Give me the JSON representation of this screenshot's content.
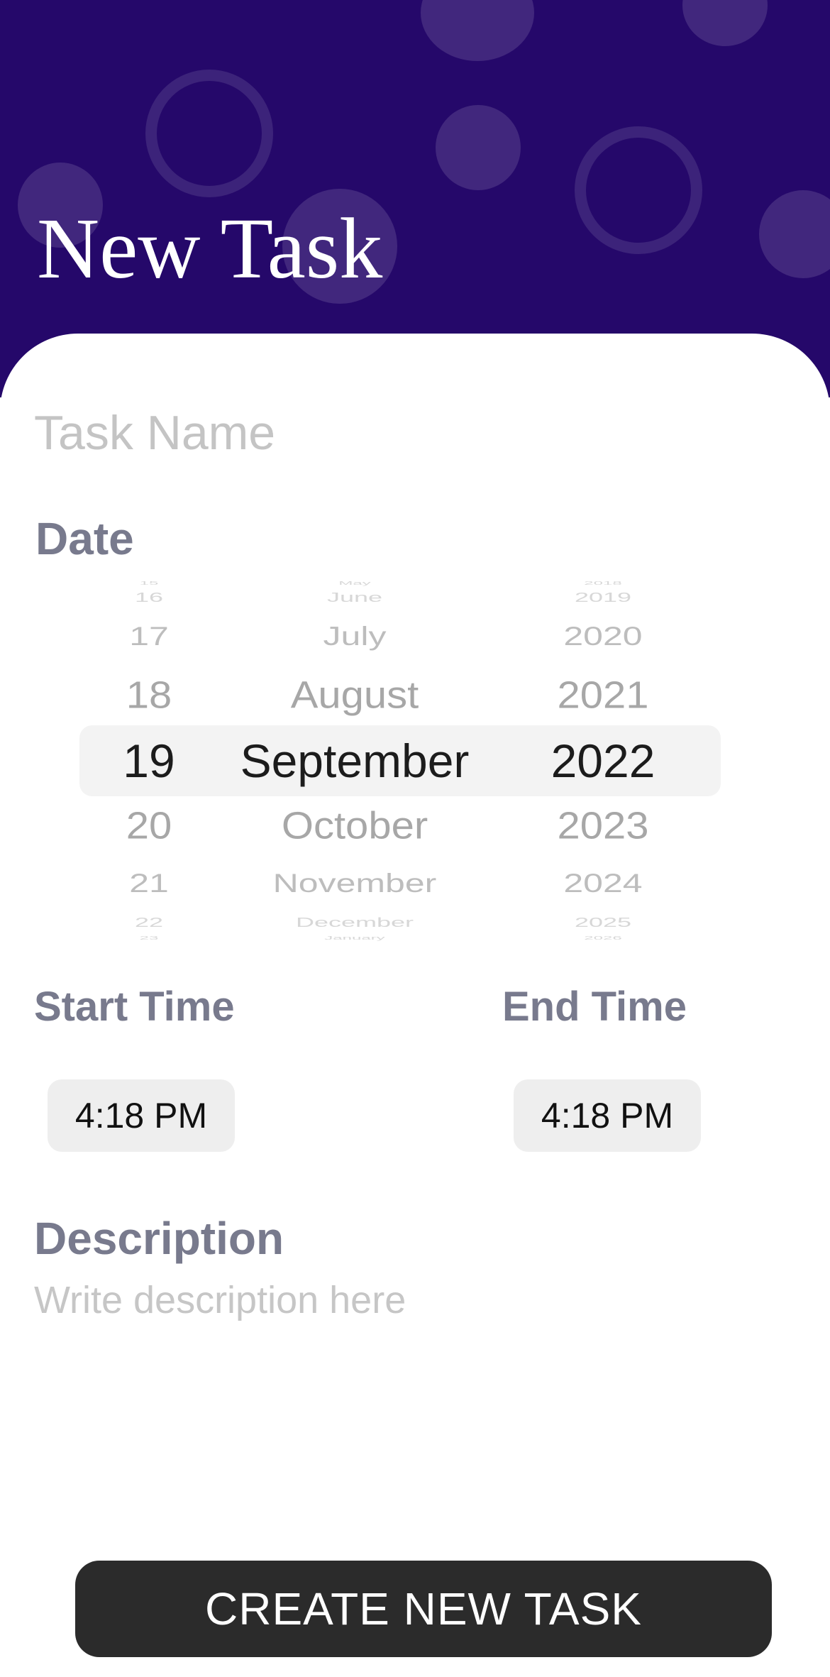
{
  "header": {
    "title": "New Task",
    "background_color": "#25086a"
  },
  "task_name": {
    "placeholder": "Task Name",
    "value": ""
  },
  "date": {
    "label": "Date",
    "day_column": [
      "15",
      "16",
      "17",
      "18",
      "19",
      "20",
      "21",
      "22",
      "23"
    ],
    "month_column": [
      "May",
      "June",
      "July",
      "August",
      "September",
      "October",
      "November",
      "December",
      "January"
    ],
    "year_column": [
      "2018",
      "2019",
      "2020",
      "2021",
      "2022",
      "2023",
      "2024",
      "2025",
      "2026"
    ],
    "selected": {
      "day": "19",
      "month": "September",
      "year": "2022"
    }
  },
  "start_time": {
    "label": "Start Time",
    "value": "4:18 PM"
  },
  "end_time": {
    "label": "End Time",
    "value": "4:18 PM"
  },
  "description": {
    "label": "Description",
    "placeholder": "Write description here",
    "value": ""
  },
  "create_button": {
    "label": "CREATE NEW TASK",
    "color": "#2b2b2b"
  }
}
